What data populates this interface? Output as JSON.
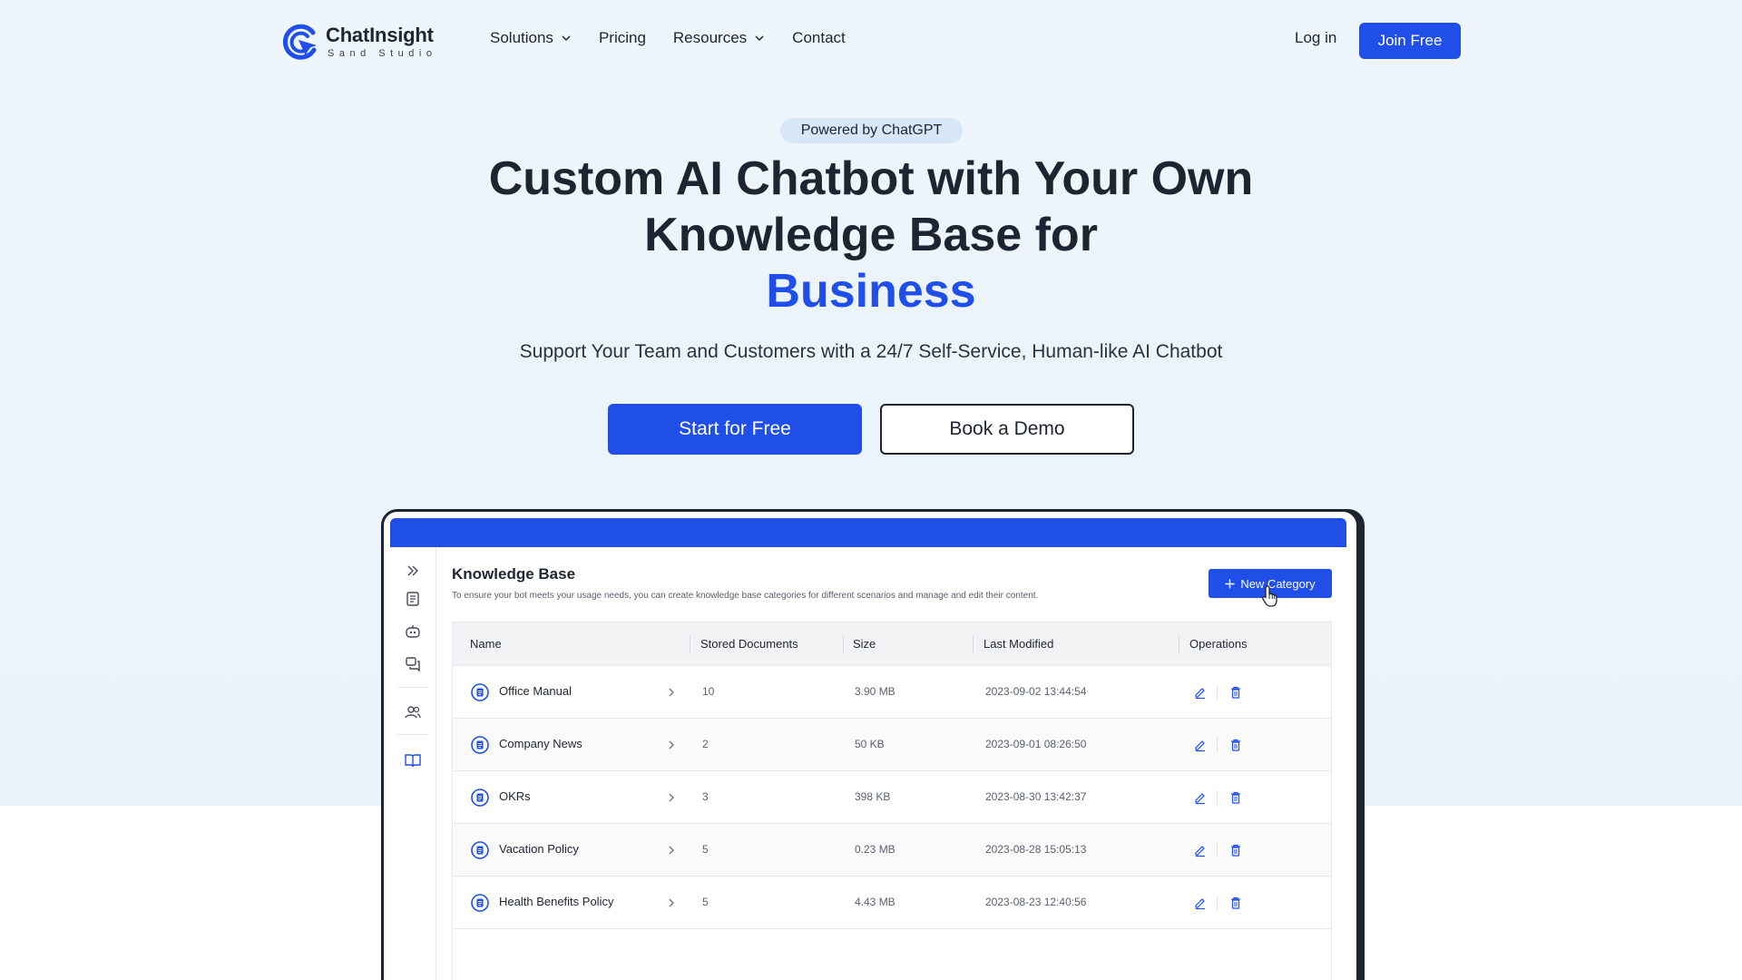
{
  "brand": {
    "name": "ChatInsight",
    "sub": "Sand Studio",
    "accent": "#1f4fe8"
  },
  "nav": {
    "items": [
      {
        "label": "Solutions",
        "dropdown": true
      },
      {
        "label": "Pricing",
        "dropdown": false
      },
      {
        "label": "Resources",
        "dropdown": true
      },
      {
        "label": "Contact",
        "dropdown": false
      }
    ],
    "login": "Log in",
    "join": "Join Free"
  },
  "hero": {
    "badge": "Powered by ChatGPT",
    "headline_line1": "Custom AI Chatbot with Your Own",
    "headline_line2": "Knowledge Base for",
    "headline_accent": "Business",
    "subhead": "Support Your Team and Customers with a 24/7 Self-Service, Human-like AI Chatbot",
    "cta_primary": "Start for Free",
    "cta_secondary": "Book a Demo"
  },
  "app": {
    "title": "Knowledge Base",
    "description": "To ensure your bot meets your usage needs, you can create knowledge base categories for different scenarios and manage and edit their content.",
    "new_category": "New Category",
    "sidebar_icons": [
      "expand-icon",
      "document-icon",
      "bot-icon",
      "chat-icon",
      "users-icon",
      "book-icon"
    ],
    "columns": [
      "Name",
      "Stored Documents",
      "Size",
      "Last Modified",
      "Operations"
    ],
    "rows": [
      {
        "name": "Office Manual",
        "docs": "10",
        "size": "3.90 MB",
        "modified": "2023-09-02 13:44:54"
      },
      {
        "name": "Company News",
        "docs": "2",
        "size": "50 KB",
        "modified": "2023-09-01 08:26:50"
      },
      {
        "name": "OKRs",
        "docs": "3",
        "size": "398 KB",
        "modified": "2023-08-30 13:42:37"
      },
      {
        "name": "Vacation Policy",
        "docs": "5",
        "size": "0.23 MB",
        "modified": "2023-08-28 15:05:13"
      },
      {
        "name": "Health Benefits Policy",
        "docs": "5",
        "size": "4.43 MB",
        "modified": "2023-08-23 12:40:56"
      }
    ]
  }
}
